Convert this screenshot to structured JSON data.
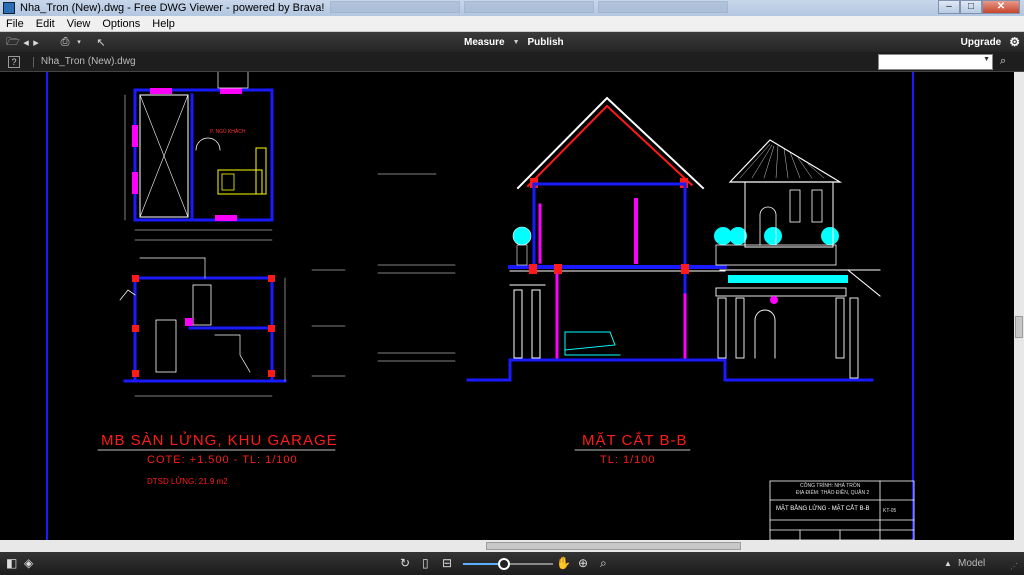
{
  "window": {
    "title": "Nha_Tron (New).dwg - Free DWG Viewer - powered by Brava!",
    "min": "–",
    "max": "□",
    "close": "✕"
  },
  "menu": [
    "File",
    "Edit",
    "View",
    "Options",
    "Help"
  ],
  "toolbar": {
    "measure": "Measure",
    "publish": "Publish",
    "upgrade": "Upgrade"
  },
  "doc": {
    "help": "?",
    "tab": "Nha_Tron (New).dwg",
    "search_placeholder": ""
  },
  "drawing": {
    "left_title": "MB SÀN LỬNG, KHU GARAGE",
    "left_subtitle": "COTE: +1.500 - TL: 1/100",
    "left_note": "DTSD LỬNG: 21.9 m2",
    "room_label": "P. NGỦ KHÁCH",
    "right_title": "MẶT CẮT B-B",
    "right_subtitle": "TL: 1/100",
    "stamp": {
      "project": "CÔNG TRÌNH: NHÀ TRÒN",
      "location": "ĐỊA ĐIỂM: THẢO ĐIỀN, QUẬN 2",
      "drawing_name": "MẶT BẰNG LỬNG - MẶT CẮT B-B",
      "sheet": "KT-05"
    }
  },
  "status": {
    "model": "Model",
    "zoom_level": 0.45
  },
  "colors": {
    "wall": "#1a1aff",
    "column": "#ff1a1a",
    "magenta": "#ff00ff",
    "cyan": "#00ffff",
    "text_red": "#ff1a1a"
  }
}
